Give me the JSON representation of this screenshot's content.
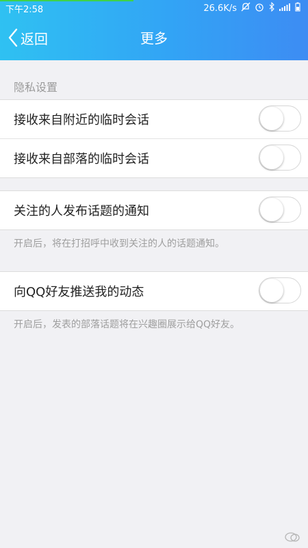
{
  "status_bar": {
    "time": "下午2:58",
    "net_speed": "26.6K/s",
    "icons": [
      "mute-icon",
      "alarm-icon",
      "wifi-icon",
      "signal-icon",
      "battery-icon"
    ]
  },
  "nav": {
    "back_label": "返回",
    "title": "更多"
  },
  "privacy": {
    "section_label": "隐私设置",
    "items": [
      {
        "label": "接收来自附近的临时会话",
        "enabled": false
      },
      {
        "label": "接收来自部落的临时会话",
        "enabled": false
      }
    ]
  },
  "topic_notify": {
    "label": "关注的人发布话题的通知",
    "enabled": false,
    "note": "开启后，将在打招呼中收到关注的人的话题通知。"
  },
  "qq_push": {
    "label": "向QQ好友推送我的动态",
    "enabled": false,
    "note": "开启后，发表的部落话题将在兴趣圈展示给QQ好友。"
  },
  "colors": {
    "header_start": "#2fc1f2",
    "header_end": "#3d8cf3",
    "background": "#f1f1f4"
  }
}
